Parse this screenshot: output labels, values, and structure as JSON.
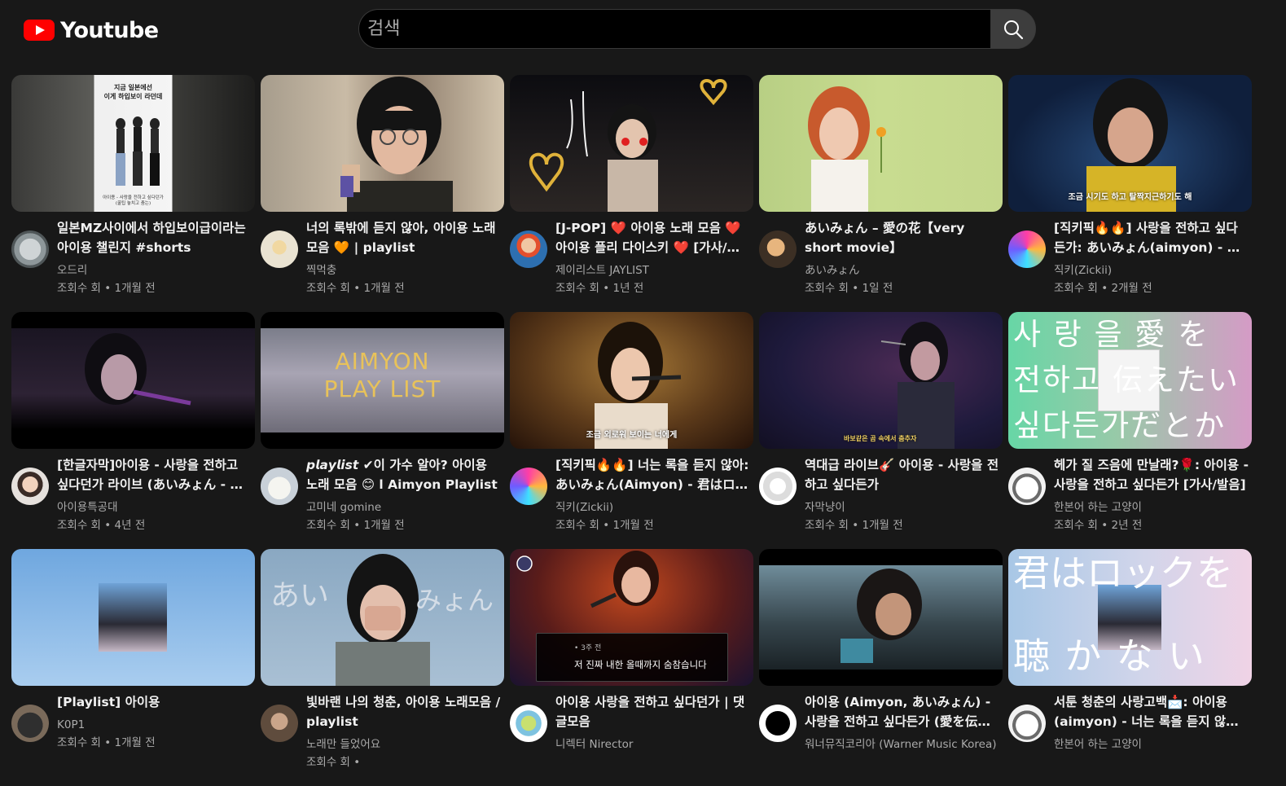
{
  "app": {
    "logo_text": "Youtube"
  },
  "search": {
    "placeholder": "검색",
    "value": ""
  },
  "colors": {
    "background": "#181818",
    "brand": "#ff0000",
    "text": "#f1f1f1",
    "muted": "#aaaaaa"
  },
  "videos": [
    {
      "title": "일본MZ사이에서 하입보이급이라는 아이용 챌린지 #shorts",
      "channel": "오드리",
      "views_label": "조회수 회",
      "age": "1개월 전",
      "thumb_text": [
        "지금 일본에선",
        "이게 하입보이 라던데",
        "아이용 - 사랑을 전하고 싶다던가",
        "(꿀팁 놓치고 춤는)"
      ]
    },
    {
      "title": "너의 록밖에 듣지 않아, 아이용 노래 모음 🧡 | playlist",
      "channel": "찍먹충",
      "views_label": "조회수 회",
      "age": "1개월 전"
    },
    {
      "title": "[J-POP] ❤️ 아이용 노래 모음 ❤️ 아이용 플리 다이스키 ❤️ [가사/발음]",
      "channel": "제이리스트 JAYLIST",
      "views_label": "조회수 회",
      "age": "1년 전"
    },
    {
      "title": "あいみょん – 愛の花【very short movie】",
      "channel": "あいみょん",
      "views_label": "조회수 회",
      "age": "1일 전"
    },
    {
      "title": "[직키픽🔥🔥] 사랑을 전하고 싶다든가: あいみょん(aimyon) - 愛を伝えたいだとか",
      "channel": "직키(Zickii)",
      "views_label": "조회수 회",
      "age": "2개월 전",
      "thumb_text": [
        "조금 시기도 하고 탈짝지근하기도 해"
      ]
    },
    {
      "title": "[한글자막]아이용 - 사랑을 전하고 싶다던가 라이브 (あいみょん - 愛を伝えたいだとか)",
      "channel": "아이용특공대",
      "views_label": "조회수 회",
      "age": "4년 전"
    },
    {
      "title": "𝙥𝙡𝙖𝙮𝙡𝙞𝙨𝙩 ✔이 가수 알아? 아이용 노래 모음 😊 l Aimyon Playlist",
      "channel": "고미네 gomine",
      "views_label": "조회수 회",
      "age": "1개월 전",
      "thumb_text": [
        "AIMYON",
        "PLAY LIST"
      ]
    },
    {
      "title": "[직키픽🔥🔥] 너는 록을 듣지 않아: あいみょん(Aimyon) - 君はロックを聴かない",
      "channel": "직키(Zickii)",
      "views_label": "조회수 회",
      "age": "1개월 전",
      "thumb_text": [
        "조금 외로워 보이는 너에게"
      ]
    },
    {
      "title": "역대급 라이브🎸 아이용 - 사랑을 전하고 싶다든가",
      "channel": "자막냥이",
      "views_label": "조회수 회",
      "age": "1개월 전",
      "thumb_text": [
        "바보같은 곰 속에서 춤추자"
      ]
    },
    {
      "title": "헤가 질 즈음에 만날래?🌹: 아이용 - 사랑을 전하고 싶다든가 [가사/발음]",
      "channel": "한본어 하는 고양이",
      "views_label": "조회수 회",
      "age": "2년 전",
      "thumb_text": [
        "사 랑 을 愛 を",
        "전하고 伝えたい",
        "싶다든가だとか"
      ]
    },
    {
      "title": "[Playlist] 아이용",
      "channel": "K0P1",
      "views_label": "조회수 회",
      "age": "1개월 전"
    },
    {
      "title": "빛바랜 나의 청춘, 아이용 노래모음 / playlist",
      "channel": "노래만 들었어요",
      "views_label": "조회수 회",
      "age": "",
      "thumb_text": [
        "あい",
        "みょん"
      ]
    },
    {
      "title": "아이용 사랑을 전하고 싶다던가 | 댓글모음",
      "channel": "니렉터 Nirector",
      "views_label": "조회수 회",
      "age": "",
      "thumb_text": [
        "• 3주 전",
        "저 진짜 내한 올때까지 숨참습니다"
      ]
    },
    {
      "title": "아이용 (Aimyon, あいみょん) - 사랑을 전하고 싶다든가 (愛を伝えたいだとか) / Live",
      "channel": "워너뮤직코리아 (Warner Music Korea)",
      "views_label": "조회수 회",
      "age": ""
    },
    {
      "title": "서툰 청춘의 사랑고백📩: 아이용 (aimyon) - 너는 록을 듣지 않아 [가사/발음]",
      "channel": "한본어 하는 고양이",
      "views_label": "조회수 회",
      "age": "",
      "thumb_text": [
        "君はロックを",
        "聴 か な い"
      ]
    }
  ]
}
